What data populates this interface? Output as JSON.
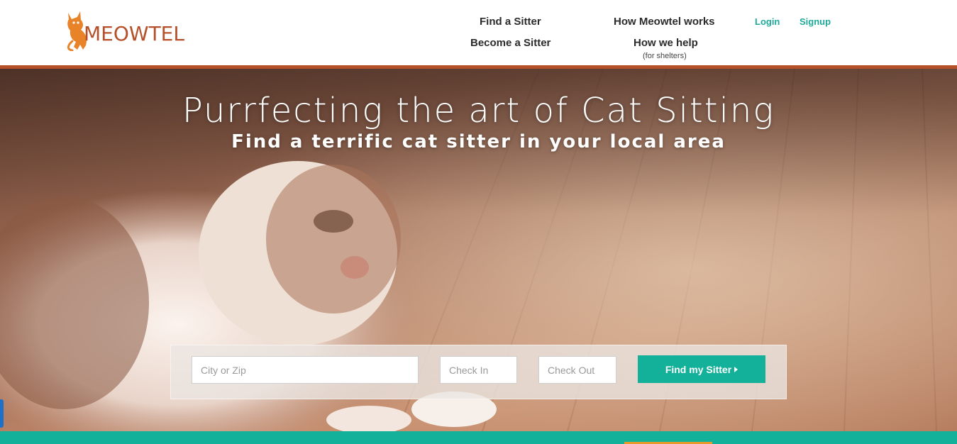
{
  "brand": {
    "name": "MEOWTEL",
    "logo_icon": "cat-logo-icon"
  },
  "nav": {
    "find_sitter": "Find a Sitter",
    "become_sitter": "Become a Sitter",
    "how_works": "How Meowtel works",
    "how_help": "How we help",
    "how_help_sub": "(for shelters)",
    "login": "Login",
    "signup": "Signup"
  },
  "hero": {
    "title": "Purrfecting the art of Cat Sitting",
    "subtitle": "Find a terrific cat sitter in your local area",
    "image": "cat-on-wood-floor-photo"
  },
  "search": {
    "location_placeholder": "City or Zip",
    "checkin_placeholder": "Check In",
    "checkout_placeholder": "Check Out",
    "button_label": "Find my Sitter",
    "button_icon": "caret-right-icon"
  },
  "colors": {
    "brand_orange": "#b5502a",
    "logo_orange": "#e8832a",
    "nav_text": "#2b2b2b",
    "teal": "#1fa99a",
    "button_teal": "#13b09a",
    "accent_orange": "#e89a2b",
    "side_tab_blue": "#1e6fc8"
  }
}
